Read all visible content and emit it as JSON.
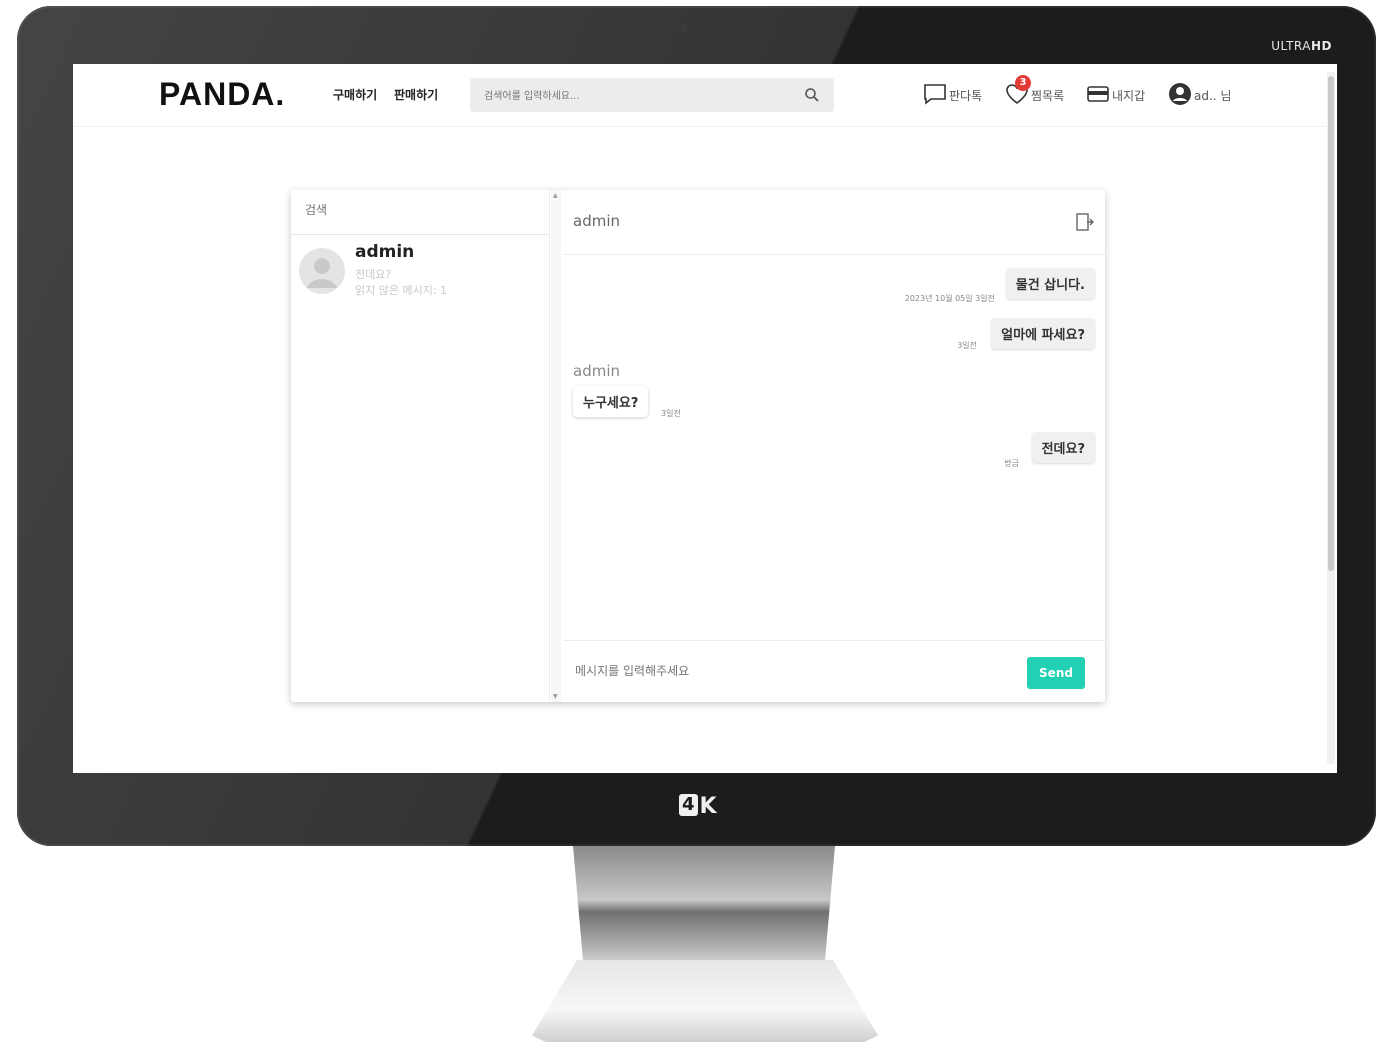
{
  "bezel": {
    "brand_label_light": "ULTRA",
    "brand_label_bold": "HD",
    "badge_box": "4",
    "badge_rest": "K"
  },
  "header": {
    "logo": "PANDA.",
    "nav": {
      "buy": "구매하기",
      "sell": "판매하기"
    },
    "search": {
      "placeholder": "검색어를 입력하세요..."
    },
    "links": {
      "talk": "판다톡",
      "wishlist": "찜목록",
      "wishlist_count": "3",
      "wallet": "내지갑",
      "user": "ad.. 님"
    }
  },
  "chat": {
    "list_search_placeholder": "검색",
    "conversation": {
      "name": "admin",
      "last_message": "전데요?",
      "unread": "읽지 않은 메시지: 1"
    },
    "title": "admin",
    "messages": [
      {
        "text": "물건 삽니다.",
        "time": "2023년 10월 05일 3일전",
        "direction": "out"
      },
      {
        "text": "얼마에 파세요?",
        "time": "3일전",
        "direction": "out"
      },
      {
        "text": "누구세요?",
        "time": "3일전",
        "direction": "in",
        "sender": "admin"
      },
      {
        "text": "전데요?",
        "time": "방금",
        "direction": "out"
      }
    ],
    "input_placeholder": "메시지를 입력해주세요",
    "send_label": "Send"
  },
  "colors": {
    "accent": "#22d0b3",
    "badge": "#e53935",
    "bezel": "#1c1c1c"
  }
}
